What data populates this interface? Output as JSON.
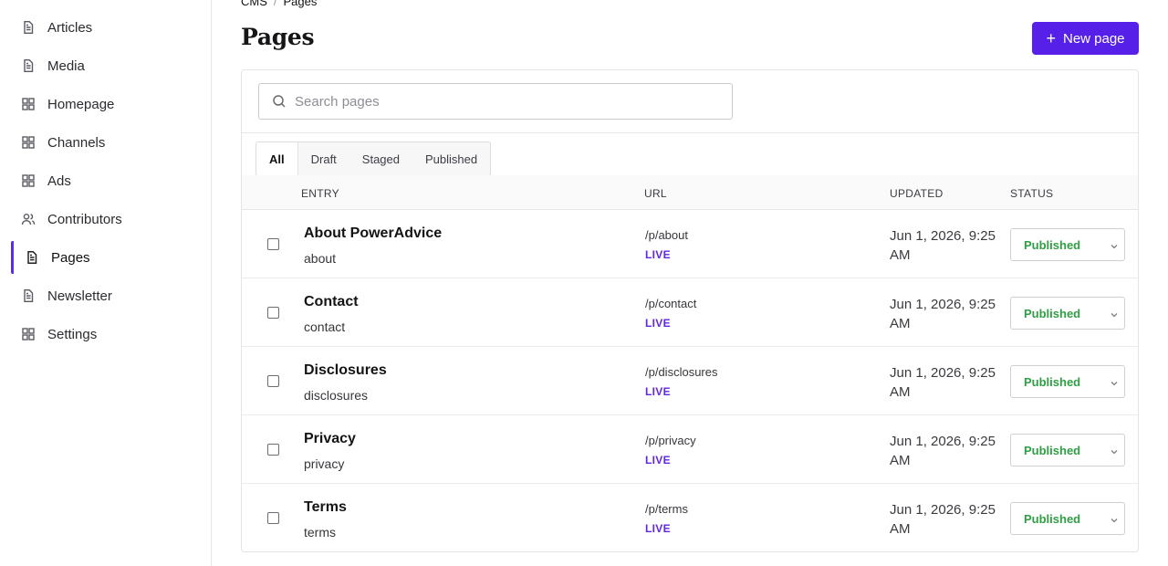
{
  "sidebar": {
    "items": [
      {
        "label": "Articles",
        "icon": "document-icon"
      },
      {
        "label": "Media",
        "icon": "document-icon"
      },
      {
        "label": "Homepage",
        "icon": "grid-icon"
      },
      {
        "label": "Channels",
        "icon": "grid-icon"
      },
      {
        "label": "Ads",
        "icon": "grid-icon"
      },
      {
        "label": "Contributors",
        "icon": "users-icon"
      },
      {
        "label": "Pages",
        "icon": "document-icon",
        "active": true
      },
      {
        "label": "Newsletter",
        "icon": "document-icon"
      },
      {
        "label": "Settings",
        "icon": "grid-icon"
      }
    ]
  },
  "breadcrumb": {
    "root": "CMS",
    "separator": "/",
    "current": "Pages"
  },
  "header": {
    "title": "Pages",
    "new_button": "New page",
    "accent": "#5620e8"
  },
  "search": {
    "placeholder": "Search pages",
    "value": ""
  },
  "tabs": [
    {
      "label": "All",
      "active": true
    },
    {
      "label": "Draft"
    },
    {
      "label": "Staged"
    },
    {
      "label": "Published"
    }
  ],
  "table": {
    "columns": {
      "entry": "ENTRY",
      "url": "URL",
      "updated": "UPDATED",
      "status": "STATUS"
    },
    "rows": [
      {
        "title": "About PowerAdvice",
        "slug": "about",
        "url": "/p/about",
        "live": "LIVE",
        "updated": "Jun 1, 2026, 9:25 AM",
        "status": "Published"
      },
      {
        "title": "Contact",
        "slug": "contact",
        "url": "/p/contact",
        "live": "LIVE",
        "updated": "Jun 1, 2026, 9:25 AM",
        "status": "Published"
      },
      {
        "title": "Disclosures",
        "slug": "disclosures",
        "url": "/p/disclosures",
        "live": "LIVE",
        "updated": "Jun 1, 2026, 9:25 AM",
        "status": "Published"
      },
      {
        "title": "Privacy",
        "slug": "privacy",
        "url": "/p/privacy",
        "live": "LIVE",
        "updated": "Jun 1, 2026, 9:25 AM",
        "status": "Published"
      },
      {
        "title": "Terms",
        "slug": "terms",
        "url": "/p/terms",
        "live": "LIVE",
        "updated": "Jun 1, 2026, 9:25 AM",
        "status": "Published"
      }
    ]
  },
  "colors": {
    "live": "#6227e0",
    "published": "#2f9e44"
  }
}
